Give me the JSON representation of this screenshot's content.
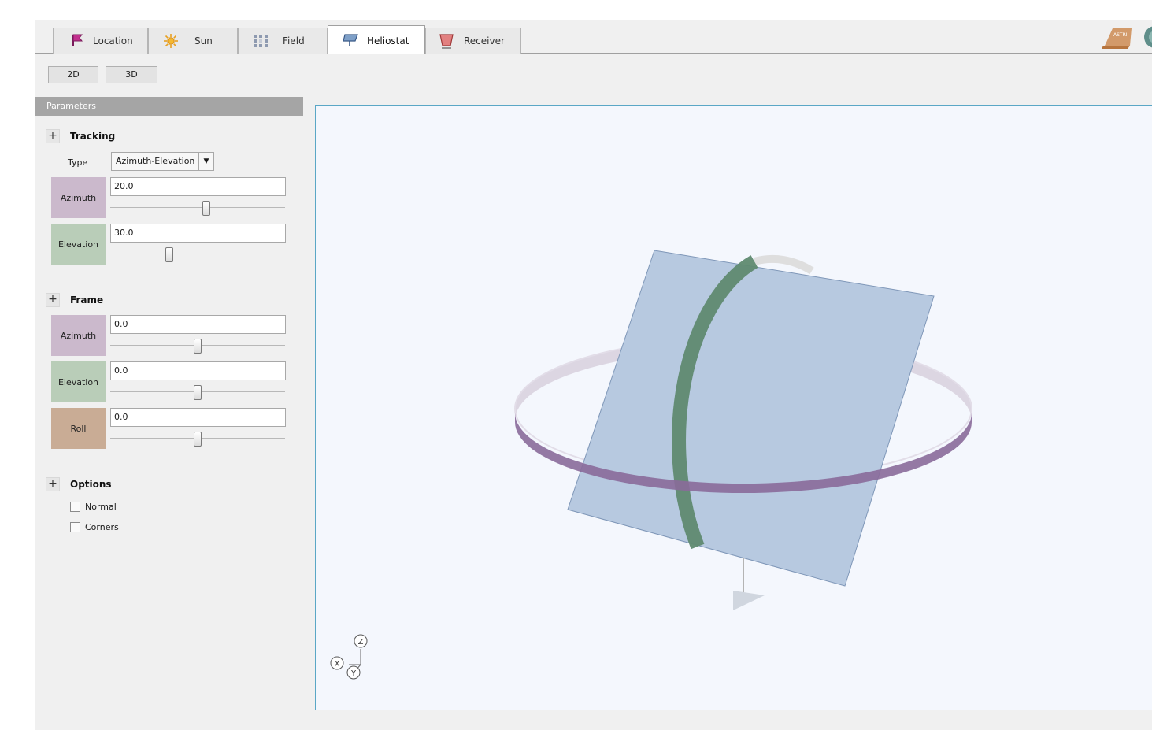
{
  "tabs": [
    {
      "label": "Location",
      "icon": "flag-icon"
    },
    {
      "label": "Sun",
      "icon": "sun-icon"
    },
    {
      "label": "Field",
      "icon": "field-grid-icon"
    },
    {
      "label": "Heliostat",
      "icon": "heliostat-icon",
      "active": true
    },
    {
      "label": "Receiver",
      "icon": "receiver-icon"
    }
  ],
  "view_buttons": {
    "b2d": "2D",
    "b3d": "3D"
  },
  "parameters_title": "Parameters",
  "tracking": {
    "title": "Tracking",
    "type_label": "Type",
    "type_value": "Azimuth-Elevation",
    "azimuth": {
      "label": "Azimuth",
      "value": "20.0",
      "slider": 0.55
    },
    "elevation": {
      "label": "Elevation",
      "value": "30.0",
      "slider": 0.34
    }
  },
  "frame": {
    "title": "Frame",
    "azimuth": {
      "label": "Azimuth",
      "value": "0.0",
      "slider": 0.5
    },
    "elevation": {
      "label": "Elevation",
      "value": "0.0",
      "slider": 0.5
    },
    "roll": {
      "label": "Roll",
      "value": "0.0",
      "slider": 0.5
    }
  },
  "options": {
    "title": "Options",
    "normal": "Normal",
    "corners": "Corners"
  },
  "axes": {
    "x": "X",
    "y": "Y",
    "z": "Z"
  },
  "logo_text": "ASTRI",
  "colors": {
    "azimuth": "#cbb9cc",
    "elevation": "#b9cdb8",
    "roll": "#c9ac95",
    "viewport_border": "#5aa7c6",
    "panel": "#b7c9e0",
    "ring_azimuth": "#8a6a9a",
    "ring_elevation": "#5f8a70"
  }
}
